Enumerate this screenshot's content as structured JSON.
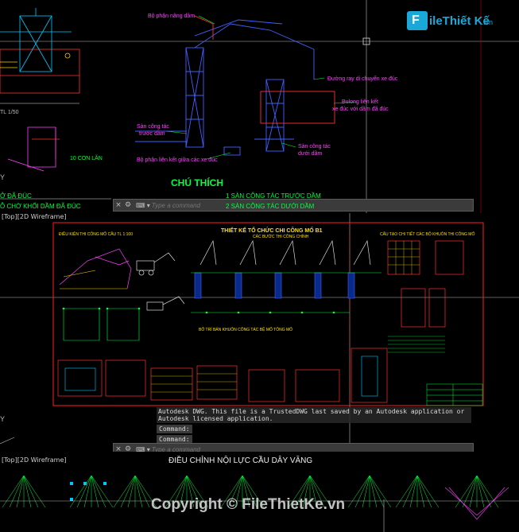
{
  "branding": {
    "logo_letter": "F",
    "logo_text": "ileThiết Kế",
    "logo_domain": ".vn",
    "watermark": "Copyright © FileThietKe.vn"
  },
  "colors": {
    "background": "#000000",
    "accent": "#1aa8d8",
    "cad_cyan": "#00c8ff",
    "cad_green": "#00ff40",
    "cad_red": "#ff2020",
    "cad_magenta": "#ff40ff",
    "cad_blue": "#4060ff"
  },
  "viewport1": {
    "label": "[Top][2D Wireframe]",
    "labels": {
      "nang_dam": "Bộ phận nâng dầm",
      "duong_ray": "Đường ray di chuyển xe đúc",
      "bulong": "Bulong liên kết",
      "bulong2": "xe đúc với dầm đã đúc",
      "san_truoc": "Sàn công tác",
      "san_truoc2": "trước dầm",
      "san_duoi": "Sàn công tác",
      "san_duoi2": "dưới dầm",
      "lien_ket": "Bộ phận liên kết giữa các xe đúc",
      "con_lan": "10 CON LĂN",
      "da_duc": "Ở ĐÃ ĐÚC",
      "cho_khoi": "Ỗ CHỜ KHỐI DẦM ĐÃ ĐÚC",
      "chu_thich": "CHÚ THÍCH",
      "item1": "1 SÀN CÔNG TÁC TRƯỚC DẦM",
      "item2": "2 SÀN CÔNG TÁC DƯỚI DẦM",
      "tl": "TL 1/50",
      "y_axis": "Y"
    }
  },
  "command_bar_top": {
    "placeholder": "Type a command",
    "close_icon": "×",
    "wrench_icon": "🔧"
  },
  "viewport2": {
    "label": "[Top][2D Wireframe]",
    "title": "THIẾT KẾ TỔ CHỨC CHI CÔNG MỐ B1",
    "subtitle": "CÁC BƯỚC THI CÔNG CHÍNH",
    "left_title": "ĐIỀU KIỆN THI CÔNG MỐ CẦU TL 1:100",
    "right_title": "CẤU TẠO CHI TIẾT CÁC BỘ KHUÔN THI CÔNG MỐ",
    "mid_title": "BỐ TRÍ BÁN KHUÔN CÔNG TÁC BỆ MỐ TÔNG MỐ",
    "y_axis": "Y"
  },
  "history": {
    "message": "Autodesk DWG.  This file is a TrustedDWG last saved by an Autodesk application or Autodesk licensed application.",
    "lines": [
      "Command:",
      "Command:"
    ]
  },
  "command_bar_bottom": {
    "placeholder": "Type a command"
  },
  "viewport3": {
    "label": "[Top][2D Wireframe]",
    "title": "ĐIỀU CHỈNH NỘI LỰC CẦU DÂY VĂNG"
  }
}
